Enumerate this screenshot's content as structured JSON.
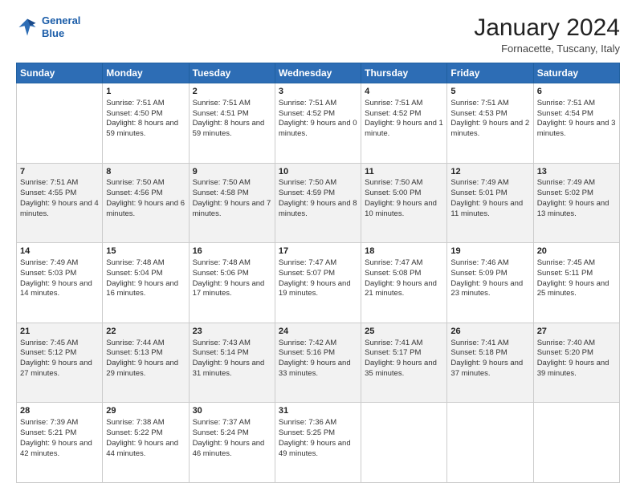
{
  "logo": {
    "line1": "General",
    "line2": "Blue"
  },
  "title": "January 2024",
  "subtitle": "Fornacette, Tuscany, Italy",
  "headers": [
    "Sunday",
    "Monday",
    "Tuesday",
    "Wednesday",
    "Thursday",
    "Friday",
    "Saturday"
  ],
  "weeks": [
    [
      {
        "day": "",
        "sunrise": "",
        "sunset": "",
        "daylight": ""
      },
      {
        "day": "1",
        "sunrise": "Sunrise: 7:51 AM",
        "sunset": "Sunset: 4:50 PM",
        "daylight": "Daylight: 8 hours and 59 minutes."
      },
      {
        "day": "2",
        "sunrise": "Sunrise: 7:51 AM",
        "sunset": "Sunset: 4:51 PM",
        "daylight": "Daylight: 8 hours and 59 minutes."
      },
      {
        "day": "3",
        "sunrise": "Sunrise: 7:51 AM",
        "sunset": "Sunset: 4:52 PM",
        "daylight": "Daylight: 9 hours and 0 minutes."
      },
      {
        "day": "4",
        "sunrise": "Sunrise: 7:51 AM",
        "sunset": "Sunset: 4:52 PM",
        "daylight": "Daylight: 9 hours and 1 minute."
      },
      {
        "day": "5",
        "sunrise": "Sunrise: 7:51 AM",
        "sunset": "Sunset: 4:53 PM",
        "daylight": "Daylight: 9 hours and 2 minutes."
      },
      {
        "day": "6",
        "sunrise": "Sunrise: 7:51 AM",
        "sunset": "Sunset: 4:54 PM",
        "daylight": "Daylight: 9 hours and 3 minutes."
      }
    ],
    [
      {
        "day": "7",
        "sunrise": "Sunrise: 7:51 AM",
        "sunset": "Sunset: 4:55 PM",
        "daylight": "Daylight: 9 hours and 4 minutes."
      },
      {
        "day": "8",
        "sunrise": "Sunrise: 7:50 AM",
        "sunset": "Sunset: 4:56 PM",
        "daylight": "Daylight: 9 hours and 6 minutes."
      },
      {
        "day": "9",
        "sunrise": "Sunrise: 7:50 AM",
        "sunset": "Sunset: 4:58 PM",
        "daylight": "Daylight: 9 hours and 7 minutes."
      },
      {
        "day": "10",
        "sunrise": "Sunrise: 7:50 AM",
        "sunset": "Sunset: 4:59 PM",
        "daylight": "Daylight: 9 hours and 8 minutes."
      },
      {
        "day": "11",
        "sunrise": "Sunrise: 7:50 AM",
        "sunset": "Sunset: 5:00 PM",
        "daylight": "Daylight: 9 hours and 10 minutes."
      },
      {
        "day": "12",
        "sunrise": "Sunrise: 7:49 AM",
        "sunset": "Sunset: 5:01 PM",
        "daylight": "Daylight: 9 hours and 11 minutes."
      },
      {
        "day": "13",
        "sunrise": "Sunrise: 7:49 AM",
        "sunset": "Sunset: 5:02 PM",
        "daylight": "Daylight: 9 hours and 13 minutes."
      }
    ],
    [
      {
        "day": "14",
        "sunrise": "Sunrise: 7:49 AM",
        "sunset": "Sunset: 5:03 PM",
        "daylight": "Daylight: 9 hours and 14 minutes."
      },
      {
        "day": "15",
        "sunrise": "Sunrise: 7:48 AM",
        "sunset": "Sunset: 5:04 PM",
        "daylight": "Daylight: 9 hours and 16 minutes."
      },
      {
        "day": "16",
        "sunrise": "Sunrise: 7:48 AM",
        "sunset": "Sunset: 5:06 PM",
        "daylight": "Daylight: 9 hours and 17 minutes."
      },
      {
        "day": "17",
        "sunrise": "Sunrise: 7:47 AM",
        "sunset": "Sunset: 5:07 PM",
        "daylight": "Daylight: 9 hours and 19 minutes."
      },
      {
        "day": "18",
        "sunrise": "Sunrise: 7:47 AM",
        "sunset": "Sunset: 5:08 PM",
        "daylight": "Daylight: 9 hours and 21 minutes."
      },
      {
        "day": "19",
        "sunrise": "Sunrise: 7:46 AM",
        "sunset": "Sunset: 5:09 PM",
        "daylight": "Daylight: 9 hours and 23 minutes."
      },
      {
        "day": "20",
        "sunrise": "Sunrise: 7:45 AM",
        "sunset": "Sunset: 5:11 PM",
        "daylight": "Daylight: 9 hours and 25 minutes."
      }
    ],
    [
      {
        "day": "21",
        "sunrise": "Sunrise: 7:45 AM",
        "sunset": "Sunset: 5:12 PM",
        "daylight": "Daylight: 9 hours and 27 minutes."
      },
      {
        "day": "22",
        "sunrise": "Sunrise: 7:44 AM",
        "sunset": "Sunset: 5:13 PM",
        "daylight": "Daylight: 9 hours and 29 minutes."
      },
      {
        "day": "23",
        "sunrise": "Sunrise: 7:43 AM",
        "sunset": "Sunset: 5:14 PM",
        "daylight": "Daylight: 9 hours and 31 minutes."
      },
      {
        "day": "24",
        "sunrise": "Sunrise: 7:42 AM",
        "sunset": "Sunset: 5:16 PM",
        "daylight": "Daylight: 9 hours and 33 minutes."
      },
      {
        "day": "25",
        "sunrise": "Sunrise: 7:41 AM",
        "sunset": "Sunset: 5:17 PM",
        "daylight": "Daylight: 9 hours and 35 minutes."
      },
      {
        "day": "26",
        "sunrise": "Sunrise: 7:41 AM",
        "sunset": "Sunset: 5:18 PM",
        "daylight": "Daylight: 9 hours and 37 minutes."
      },
      {
        "day": "27",
        "sunrise": "Sunrise: 7:40 AM",
        "sunset": "Sunset: 5:20 PM",
        "daylight": "Daylight: 9 hours and 39 minutes."
      }
    ],
    [
      {
        "day": "28",
        "sunrise": "Sunrise: 7:39 AM",
        "sunset": "Sunset: 5:21 PM",
        "daylight": "Daylight: 9 hours and 42 minutes."
      },
      {
        "day": "29",
        "sunrise": "Sunrise: 7:38 AM",
        "sunset": "Sunset: 5:22 PM",
        "daylight": "Daylight: 9 hours and 44 minutes."
      },
      {
        "day": "30",
        "sunrise": "Sunrise: 7:37 AM",
        "sunset": "Sunset: 5:24 PM",
        "daylight": "Daylight: 9 hours and 46 minutes."
      },
      {
        "day": "31",
        "sunrise": "Sunrise: 7:36 AM",
        "sunset": "Sunset: 5:25 PM",
        "daylight": "Daylight: 9 hours and 49 minutes."
      },
      {
        "day": "",
        "sunrise": "",
        "sunset": "",
        "daylight": ""
      },
      {
        "day": "",
        "sunrise": "",
        "sunset": "",
        "daylight": ""
      },
      {
        "day": "",
        "sunrise": "",
        "sunset": "",
        "daylight": ""
      }
    ]
  ]
}
